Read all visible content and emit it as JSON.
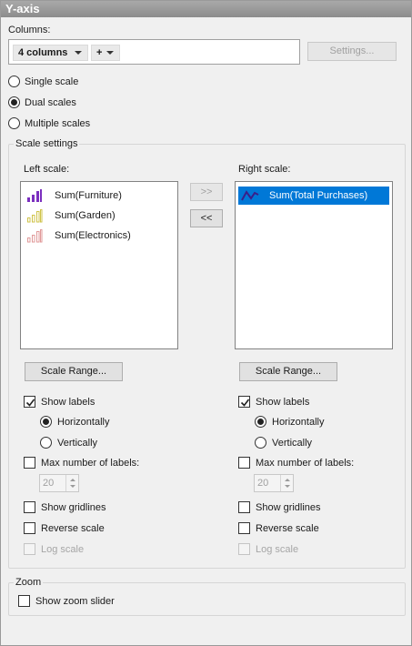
{
  "title": "Y-axis",
  "columns": {
    "label": "Columns:",
    "chip_count": "4 columns",
    "chip_add": "+",
    "settings_button": "Settings..."
  },
  "scale_mode": {
    "options": [
      "Single scale",
      "Dual scales",
      "Multiple scales"
    ],
    "selected": "Dual scales"
  },
  "scale_settings": {
    "group_title": "Scale settings",
    "left": {
      "label": "Left scale:",
      "items": [
        {
          "label": "Sum(Furniture)",
          "icon": "bar-chart-icon",
          "color": "#7b2fbf"
        },
        {
          "label": "Sum(Garden)",
          "icon": "bar-chart-icon",
          "color": "#cfc34a"
        },
        {
          "label": "Sum(Electronics)",
          "icon": "bar-chart-icon",
          "color": "#e09a9a"
        }
      ]
    },
    "right": {
      "label": "Right scale:",
      "items": [
        {
          "label": "Sum(Total Purchases)",
          "icon": "line-chart-icon",
          "color": "#3a1f8a",
          "selected": true
        }
      ]
    },
    "move_right_button": ">>",
    "move_left_button": "<<",
    "scale_range_button": "Scale Range...",
    "show_labels": "Show labels",
    "horizontally": "Horizontally",
    "vertically": "Vertically",
    "max_labels": "Max number of labels:",
    "max_labels_value": "20",
    "show_gridlines": "Show gridlines",
    "reverse_scale": "Reverse scale",
    "log_scale": "Log scale"
  },
  "zoom": {
    "group_title": "Zoom",
    "show_zoom_slider": "Show zoom slider"
  },
  "colors": {
    "selection": "#0078d7",
    "title_bar": "#999999"
  }
}
